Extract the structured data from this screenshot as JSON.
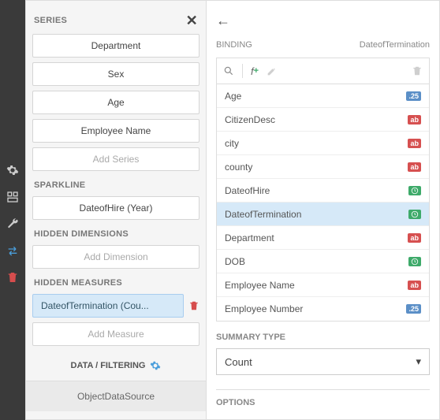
{
  "left": {
    "series_label": "SERIES",
    "series": [
      "Department",
      "Sex",
      "Age",
      "Employee Name"
    ],
    "add_series": "Add Series",
    "sparkline_label": "SPARKLINE",
    "sparkline_item": "DateofHire (Year)",
    "hidden_dim_label": "HIDDEN DIMENSIONS",
    "add_dimension": "Add Dimension",
    "hidden_meas_label": "HIDDEN MEASURES",
    "hidden_meas_item": "DateofTermination (Cou...",
    "add_measure": "Add Measure",
    "data_filtering": "DATA / FILTERING",
    "datasource": "ObjectDataSource"
  },
  "right": {
    "binding_label": "BINDING",
    "binding_field": "DateofTermination",
    "fields": [
      {
        "name": "Age",
        "type": "num"
      },
      {
        "name": "CitizenDesc",
        "type": "txt"
      },
      {
        "name": "city",
        "type": "txt"
      },
      {
        "name": "county",
        "type": "txt"
      },
      {
        "name": "DateofHire",
        "type": "date"
      },
      {
        "name": "DateofTermination",
        "type": "date",
        "selected": true
      },
      {
        "name": "Department",
        "type": "txt"
      },
      {
        "name": "DOB",
        "type": "date"
      },
      {
        "name": "Employee Name",
        "type": "txt"
      },
      {
        "name": "Employee Number",
        "type": "num"
      }
    ],
    "summary_label": "SUMMARY TYPE",
    "summary_value": "Count",
    "options_label": "OPTIONS"
  },
  "badges": {
    "num": ".25",
    "txt": "ab",
    "date": "⏱"
  }
}
